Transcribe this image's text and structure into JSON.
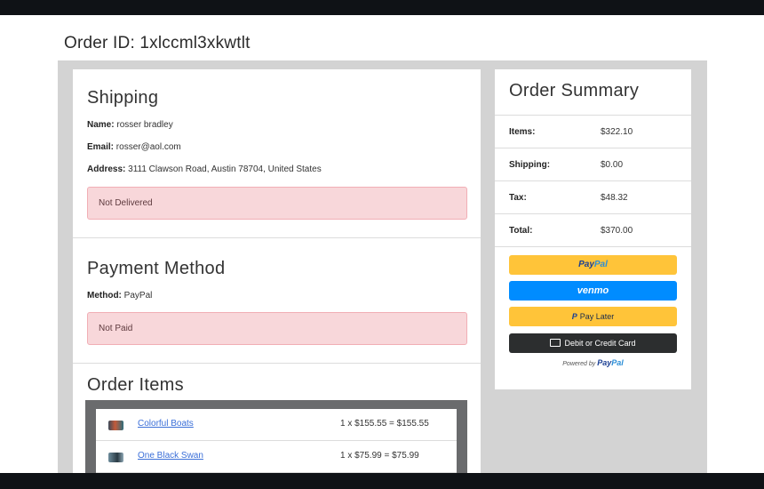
{
  "page": {
    "order_id_label": "Order ID: 1xlccml3xkwtlt"
  },
  "shipping": {
    "title": "Shipping",
    "name_label": "Name:",
    "name_value": "rosser bradley",
    "email_label": "Email:",
    "email_value": "rosser@aol.com",
    "address_label": "Address:",
    "address_value": "3111 Clawson Road, Austin 78704, United States",
    "status": "Not Delivered"
  },
  "payment": {
    "title": "Payment Method",
    "method_label": "Method:",
    "method_value": "PayPal",
    "status": "Not Paid"
  },
  "order_items": {
    "title": "Order Items",
    "items": [
      {
        "name": "Colorful Boats",
        "calc": "1 x $155.55 = $155.55",
        "thumb_icon": "painting-thumbnail-icon"
      },
      {
        "name": "One Black Swan",
        "calc": "1 x $75.99 = $75.99",
        "thumb_icon": "painting-thumbnail-icon"
      }
    ]
  },
  "summary": {
    "title": "Order Summary",
    "rows": [
      {
        "label": "Items:",
        "value": "$322.10"
      },
      {
        "label": "Shipping:",
        "value": "$0.00"
      },
      {
        "label": "Tax:",
        "value": "$48.32"
      },
      {
        "label": "Total:",
        "value": "$370.00"
      }
    ],
    "buttons": {
      "paypal_part1": "Pay",
      "paypal_part2": "Pal",
      "venmo": "venmo",
      "pay_later_mark": "P",
      "pay_later": "Pay Later",
      "card": "Debit or Credit Card"
    },
    "powered_by": "Powered by",
    "powered_brand_1": "Pay",
    "powered_brand_2": "Pal"
  },
  "colors": {
    "alert_bg": "#f8d7da",
    "paypal_yellow": "#ffc439",
    "venmo_blue": "#008cff",
    "card_black": "#2c2e2f",
    "link_blue": "#3b6fd8"
  }
}
